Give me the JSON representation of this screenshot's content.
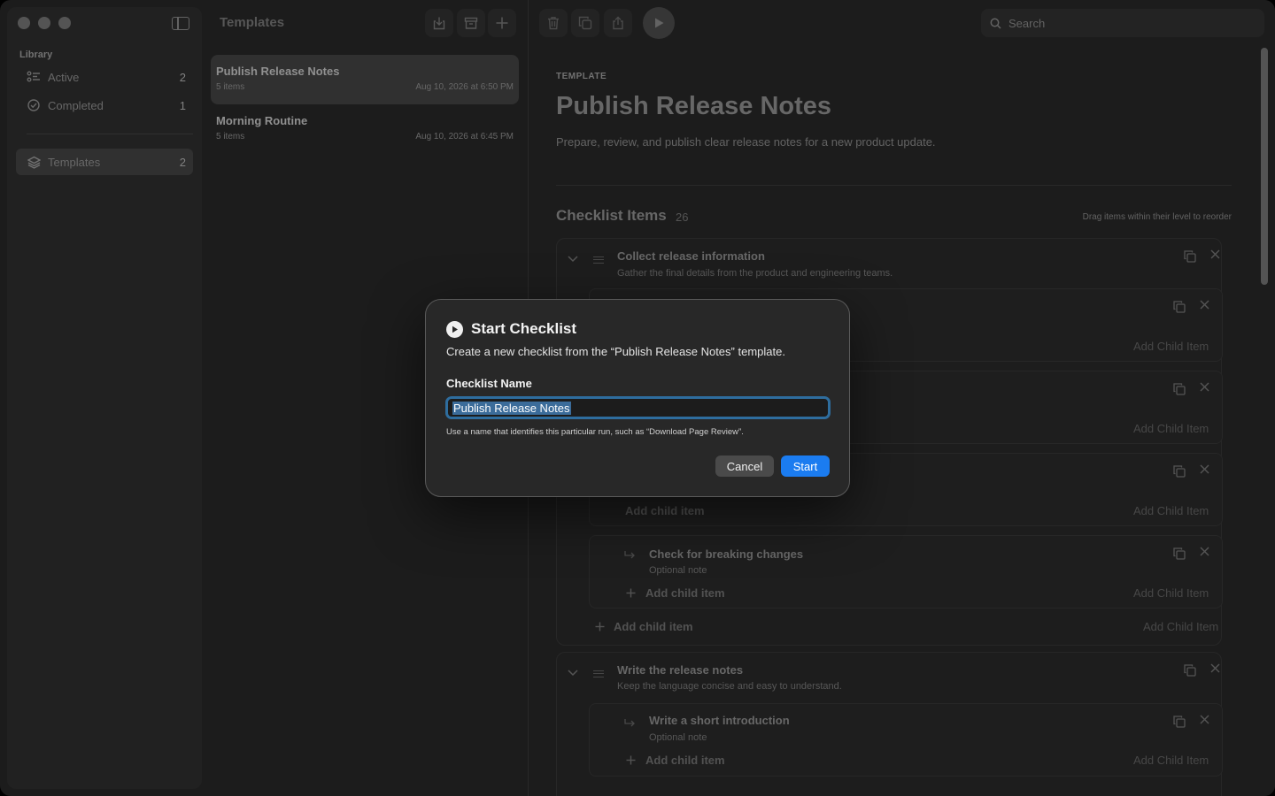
{
  "sidebar": {
    "section_header": "Library",
    "items": [
      {
        "label": "Active",
        "count": "2",
        "icon": "list-bullets-icon"
      },
      {
        "label": "Completed",
        "count": "1",
        "icon": "checkmark-circle-icon"
      },
      {
        "label": "Templates",
        "count": "2",
        "icon": "stack-icon"
      }
    ]
  },
  "list": {
    "title": "Templates",
    "templates": [
      {
        "name": "Publish Release Notes",
        "items": "5 items",
        "date": "Aug 10, 2026 at 6:50 PM"
      },
      {
        "name": "Morning Routine",
        "items": "5 items",
        "date": "Aug 10, 2026 at 6:45 PM"
      }
    ]
  },
  "detail": {
    "search_placeholder": "Search",
    "kicker": "TEMPLATE",
    "title": "Publish Release Notes",
    "description": "Prepare, review, and publish clear release notes for a new product update.",
    "checklist_title": "Checklist Items",
    "checklist_count": "26",
    "reorder_hint": "Drag items within their level to reorder",
    "groups": [
      {
        "title": "Collect release information",
        "note": "Gather the final details from the product and engineering teams.",
        "child": {
          "title": "Check for breaking changes",
          "note": "Optional note"
        }
      },
      {
        "title": "Write the release notes",
        "note": "Keep the language concise and easy to understand.",
        "child": {
          "title": "Write a short introduction",
          "note": "Optional note"
        }
      }
    ],
    "add_child_item": "Add child item",
    "add_child_item_right": "Add Child Item"
  },
  "dialog": {
    "title": "Start Checklist",
    "description": "Create a new checklist from the “Publish Release Notes” template.",
    "field_label": "Checklist Name",
    "field_value": "Publish Release Notes",
    "help": "Use a name that identifies this particular run, such as “Download Page Review”.",
    "cancel": "Cancel",
    "start": "Start"
  },
  "colors": {
    "accent": "#1b7cf0",
    "focus_ring": "#2e6d9e",
    "selection": "#3b6c9a"
  }
}
